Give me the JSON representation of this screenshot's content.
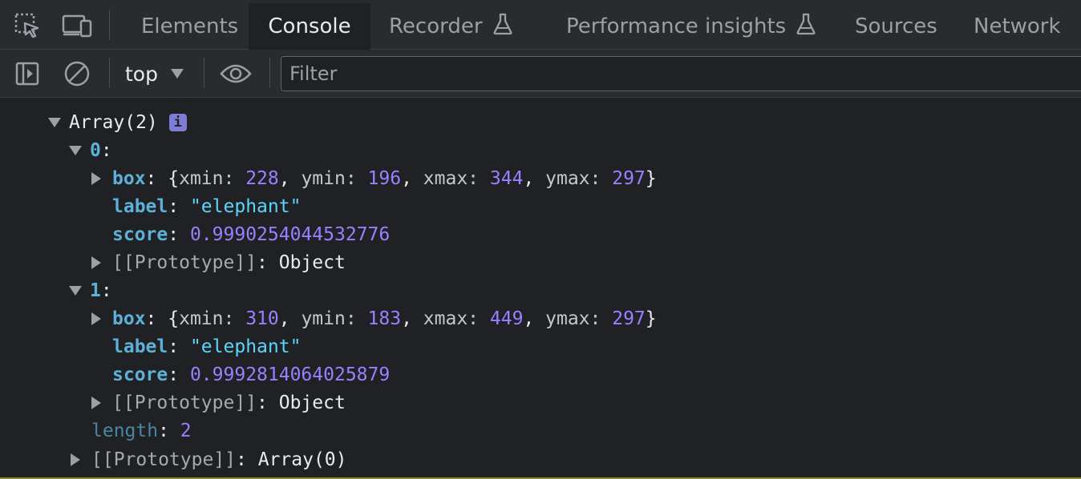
{
  "tabs": [
    {
      "label": "Elements",
      "active": false
    },
    {
      "label": "Console",
      "active": true
    },
    {
      "label": "Recorder",
      "active": false,
      "experimental": true
    },
    {
      "label": "Performance insights",
      "active": false,
      "experimental": true
    },
    {
      "label": "Sources",
      "active": false
    },
    {
      "label": "Network",
      "active": false
    }
  ],
  "toolbar": {
    "context": "top",
    "filter_placeholder": "Filter"
  },
  "icons": {
    "inspect": "inspect-element-icon",
    "device": "device-toolbar-icon",
    "sidebar": "sidebar-toggle-icon",
    "clear": "clear-console-icon",
    "eye": "live-expression-icon",
    "flask": "experimental-flask-icon"
  },
  "colors": {
    "background": "#202124",
    "key": "#5db0d7",
    "number": "#9980ff",
    "string": "#5cd5fb"
  },
  "console": {
    "array_header": "Array(2)",
    "info": "i",
    "items": [
      {
        "index": "0",
        "box": {
          "xmin": "228",
          "ymin": "196",
          "xmax": "344",
          "ymax": "297"
        },
        "label": "\"elephant\"",
        "score": "0.9990254044532776",
        "proto": "Object"
      },
      {
        "index": "1",
        "box": {
          "xmin": "310",
          "ymin": "183",
          "xmax": "449",
          "ymax": "297"
        },
        "label": "\"elephant\"",
        "score": "0.9992814064025879",
        "proto": "Object"
      }
    ],
    "length_key": "length",
    "length_value": "2",
    "proto_key": "[[Prototype]]",
    "array_proto": "Array(0)"
  }
}
